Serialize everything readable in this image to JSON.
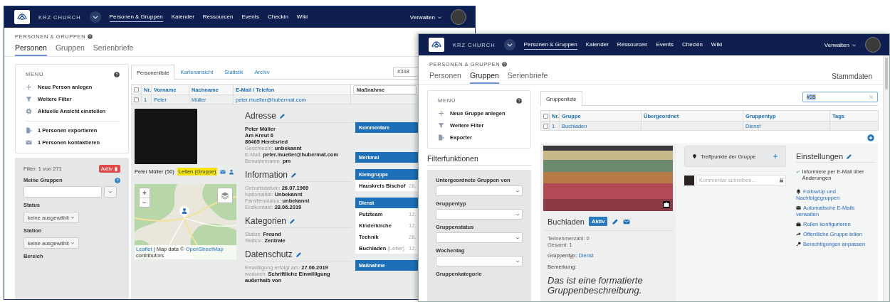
{
  "person_window": {
    "header": {
      "brand": "KRZ CHURCH",
      "nav": [
        {
          "label": "Personen & Gruppen",
          "selected": true
        },
        {
          "label": "Kalender",
          "selected": false
        },
        {
          "label": "Ressourcen",
          "selected": false
        },
        {
          "label": "Events",
          "selected": false
        },
        {
          "label": "Checkin",
          "selected": false
        },
        {
          "label": "Wiki",
          "selected": false
        }
      ],
      "user_menu": "Verwalten"
    },
    "breadcrumb": "PERSONEN & GRUPPEN",
    "tabs": [
      {
        "label": "Personen",
        "selected": true
      },
      {
        "label": "Gruppen",
        "selected": false
      },
      {
        "label": "Serienbriefe",
        "selected": false
      }
    ],
    "menu": {
      "title": "MENÜ",
      "sections": [
        {
          "items": [
            "Neue Person anlegen",
            "Weitere Filter",
            "Aktuelle Ansicht einstellen"
          ]
        },
        {
          "items": [
            "1 Personen exportieren",
            "1 Personen kontaktieren"
          ]
        }
      ]
    },
    "filter": {
      "count": "Filter: 1 von 271",
      "badge": "Aktiv",
      "fields": [
        {
          "label": "Meine Gruppen",
          "kind": "combobox",
          "help": true
        },
        {
          "label": "Status",
          "kind": "dropdown",
          "value": "keine ausgewählt",
          "help": false
        },
        {
          "label": "Station",
          "kind": "dropdown",
          "value": "keine ausgewählt",
          "help": false
        },
        {
          "label": "Bereich",
          "kind": "label",
          "help": false
        }
      ]
    },
    "subtabs": [
      {
        "label": "Personenliste",
        "selected": true
      },
      {
        "label": "Kartenansicht",
        "selected": false
      },
      {
        "label": "Statistik",
        "selected": false
      },
      {
        "label": "Archiv",
        "selected": false
      }
    ],
    "search": {
      "value": "#348"
    },
    "table": {
      "all_checked": false,
      "columns": [
        "Nr.",
        "Vorname",
        "Nachname",
        "E-Mail / Telefon"
      ],
      "column_select": "Maßnahme",
      "rows": [
        {
          "checked": false,
          "cells": [
            "1",
            "Peter",
            "Müller",
            "peter.mueller@hubermat.com"
          ]
        }
      ]
    },
    "detail": {
      "name": "Peter Müller (50)",
      "role_badge": "Leiten (Gruppe)",
      "map": {
        "zoom_in": "+",
        "zoom_out": "−",
        "attribution": [
          {
            "text": "Leaflet",
            "link": true
          },
          {
            "text": " | Map data © ",
            "link": false
          },
          {
            "text": "OpenStreetMap",
            "link": true
          },
          {
            "text": " contributors",
            "link": false
          }
        ]
      },
      "sections": [
        {
          "title": "Adresse",
          "lines": [
            {
              "kind": "strong",
              "text": "Peter Müller"
            },
            {
              "kind": "strong",
              "text": "Am Kreut 6"
            },
            {
              "kind": "strong",
              "text": "86465 Heretsried"
            },
            {
              "kind": "field",
              "text": "Geschlecht: **unbekannt**"
            },
            {
              "kind": "field",
              "text": "E-Mail: **peter.mueller@hubermat.com**"
            },
            {
              "kind": "field",
              "text": "Benutzername: **pm**"
            }
          ]
        },
        {
          "title": "Information",
          "lines": [
            {
              "kind": "field",
              "text": "Geburtsdatum: **26.07.1969**"
            },
            {
              "kind": "field",
              "text": "Nationalität: **Unbekannt**"
            },
            {
              "kind": "field",
              "text": "Familienstatus: **unbekannt**"
            },
            {
              "kind": "field",
              "text": "Erstkontakt: **28.06.2019**"
            }
          ]
        },
        {
          "title": "Kategorien",
          "lines": [
            {
              "kind": "field",
              "text": "Status: **Freund**"
            },
            {
              "kind": "field",
              "text": "Station: **Zentrale**"
            }
          ]
        },
        {
          "title": "Datenschutz",
          "lines": [
            {
              "kind": "field",
              "text": "Einwilligung erfolgt am: **27.06.2019**"
            },
            {
              "kind": "field",
              "text": "wodurch: **Schriftliche Einwilligung außerhalb von**"
            }
          ]
        }
      ],
      "side_panels": [
        {
          "title": "Kommentare"
        },
        {
          "title": "Merkmal"
        },
        {
          "title": "Kleingruppe",
          "rows": [
            {
              "name": "Hauskreis Bischof",
              "date": "28."
            }
          ]
        },
        {
          "title": "Dienst",
          "rows": [
            {
              "name": "Putzteam",
              "date": "12."
            },
            {
              "name": "Kinderkirche",
              "date": "12."
            },
            {
              "name": "Technik",
              "date": "28."
            },
            {
              "name": "Buchladen",
              "note": "(Leiter)",
              "date": "12."
            }
          ]
        },
        {
          "title": "Maßnahme"
        }
      ]
    }
  },
  "group_window": {
    "header": {
      "brand": "KRZ CHURCH",
      "nav": [
        {
          "label": "Personen & Gruppen",
          "selected": true
        },
        {
          "label": "Kalender",
          "selected": false
        },
        {
          "label": "Ressourcen",
          "selected": false
        },
        {
          "label": "Events",
          "selected": false
        },
        {
          "label": "Checkin",
          "selected": false
        },
        {
          "label": "Wiki",
          "selected": false
        }
      ],
      "user_menu": "Verwalten"
    },
    "breadcrumb": "PERSONEN & GRUPPEN",
    "tabs": [
      {
        "label": "Personen",
        "selected": false
      },
      {
        "label": "Gruppen",
        "selected": true
      },
      {
        "label": "Serienbriefe",
        "selected": false
      }
    ],
    "master_data_link": "Stammdaten",
    "menu": {
      "title": "MENÜ",
      "sections": [
        {
          "items": [
            "Neue Gruppe anlegen",
            "Weitere Filter",
            "Exporter"
          ]
        }
      ]
    },
    "filter_heading": "Filterfunktionen",
    "filter": {
      "fields": [
        {
          "label": "Untergeordnete Gruppen von",
          "kind": "select"
        },
        {
          "label": "Gruppentyp",
          "kind": "select"
        },
        {
          "label": "Gruppenstatus",
          "kind": "select"
        },
        {
          "label": "Wochentag",
          "kind": "select"
        },
        {
          "label": "Gruppenkategorie",
          "kind": "label"
        }
      ]
    },
    "subtabs": [
      {
        "label": "Gruppenliste",
        "selected": true
      }
    ],
    "search": {
      "value": "#35"
    },
    "table": {
      "all_checked": false,
      "columns": [
        "Nr.",
        "Gruppe",
        "Übergeordnet",
        "Gruppentyp",
        "Tags"
      ],
      "rows": [
        {
          "checked": false,
          "cells": [
            "1",
            "Buchladen",
            null,
            "Dienst",
            null
          ]
        }
      ]
    },
    "group": {
      "title": "Buchladen",
      "status": "Aktiv",
      "stats": [
        "Teilnehmerzahl: 0",
        "Gesamt: 1"
      ],
      "type": {
        "label": "Gruppentyp:",
        "link": "Dienst"
      },
      "remark_label": "Bemerkung:",
      "description": "Das ist eine formatierte Gruppenbeschreibung."
    },
    "meeting_points": {
      "title": "Treffpunkte der Gruppe"
    },
    "comment": {
      "placeholder": "Kommentar schreiben..."
    },
    "settings": {
      "title": "Einstellungen",
      "notification": {
        "text": "Informiere per E-Mail über Änderungen",
        "checked": true
      },
      "links": [
        "FollowUp und Nachfolgegruppen",
        "Automatische E-Mails verwalten",
        "Rollen konfigurieren",
        "Öffentliche Gruppe teilen",
        "Berechtigungen anpassen"
      ]
    }
  }
}
